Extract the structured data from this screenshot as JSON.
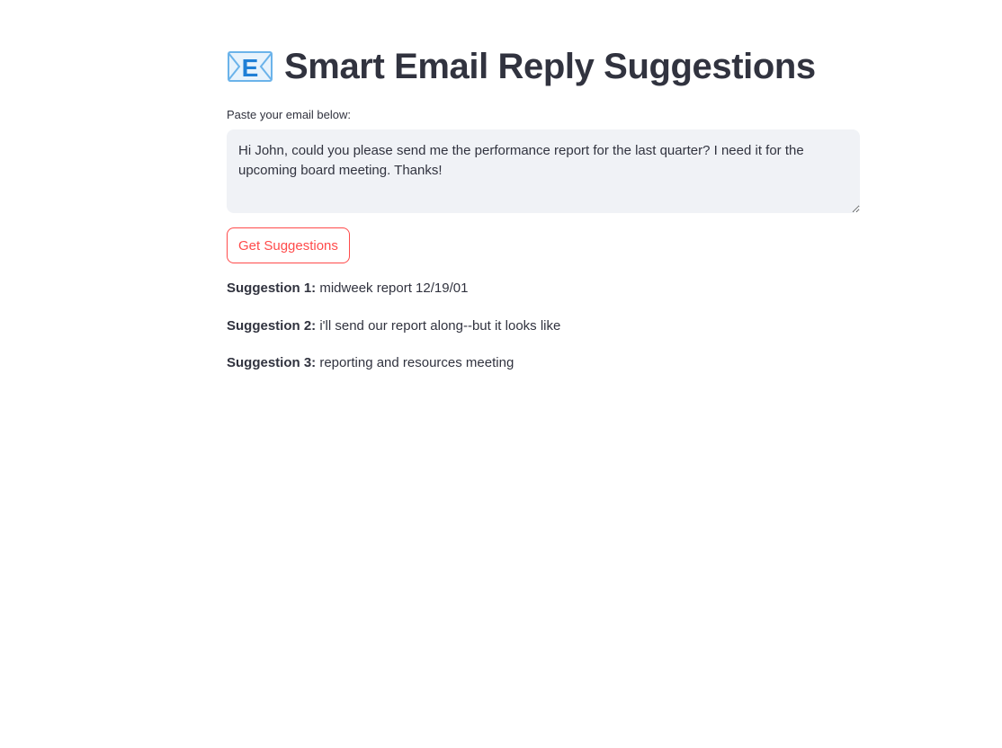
{
  "header": {
    "icon": "envelope-e-icon",
    "icon_letter": "E",
    "title": "Smart Email Reply Suggestions"
  },
  "email_input": {
    "label": "Paste your email below:",
    "value": "Hi John, could you please send me the performance report for the last quarter? I need it for the upcoming board meeting. Thanks!"
  },
  "action": {
    "button_label": "Get Suggestions"
  },
  "suggestions": [
    {
      "label": "Suggestion 1:",
      "text": "midweek report 12/19/01"
    },
    {
      "label": "Suggestion 2:",
      "text": "i'll send our report along--but it looks like"
    },
    {
      "label": "Suggestion 3:",
      "text": "reporting and resources meeting"
    }
  ],
  "colors": {
    "accent": "#ff4b4b",
    "text": "#31333f",
    "input_bg": "#f0f2f6",
    "icon_blue": "#1f7fd6"
  }
}
